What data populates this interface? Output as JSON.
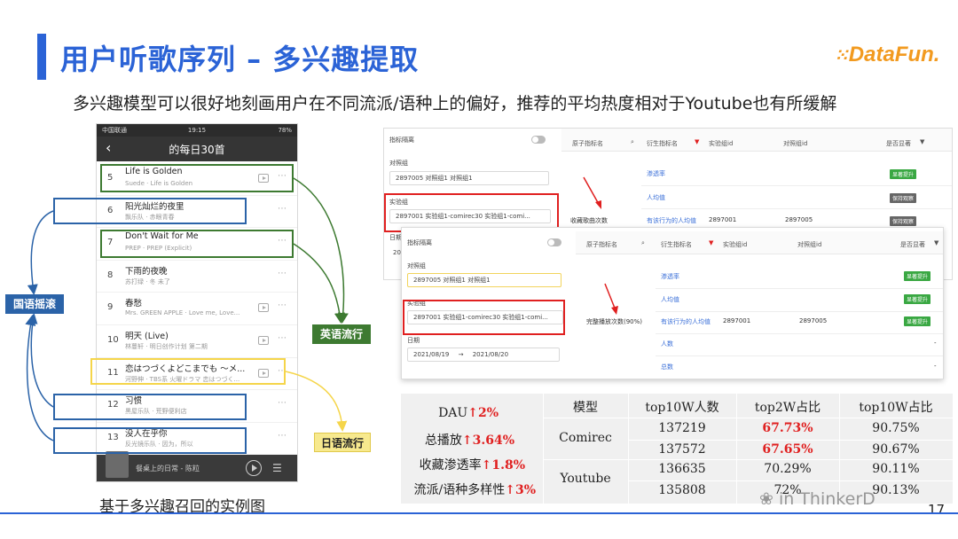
{
  "slide": {
    "title": "用户听歌序列 – 多兴趣提取",
    "logo": "DataFun.",
    "subtitle": "多兴趣模型可以很好地刻画用户在不同流派/语种上的偏好，推荐的平均热度相对于Youtube也有所缓解",
    "page_number": "17",
    "watermark": "in ThinkerD"
  },
  "phone": {
    "status_left": "中国联通",
    "status_time": "19:15",
    "status_right": "78%",
    "back_glyph": "‹",
    "header_title": "的每日30首",
    "songs": [
      {
        "num": "5",
        "name": "Life is Golden",
        "meta": "Suede · Life is Golden"
      },
      {
        "num": "6",
        "name": "阳光灿烂的夜里",
        "meta": "飘乐队 · 赤眼青春"
      },
      {
        "num": "7",
        "name": "Don't Wait for Me",
        "meta": "PREP · PREP (Explicit)"
      },
      {
        "num": "8",
        "name": "下雨的夜晚",
        "meta": "苏打绿 · 冬 未了"
      },
      {
        "num": "9",
        "name": "春愁",
        "meta": "Mrs. GREEN APPLE · Love me, Love..."
      },
      {
        "num": "10",
        "name": "明天 (Live)",
        "meta": "林蔓轩 · 明日创作计划 第二期"
      },
      {
        "num": "11",
        "name": "恋はつづくよどこまでも ～メ...",
        "meta": "河野伸 · TBS系 火曜ドラマ 恋はつづく..."
      },
      {
        "num": "12",
        "name": "习惯",
        "meta": "黑屋乐队 · 荒野便利店"
      },
      {
        "num": "13",
        "name": "没人在乎你",
        "meta": "反光镜乐队 · 因为，所以"
      }
    ],
    "player_text": "餐桌上的日常 - 陈粒",
    "caption": "基于多兴趣召回的实例图"
  },
  "annotations": {
    "guoyu": "国语摇滚",
    "yingyu": "英语流行",
    "riyu": "日语流行",
    "blue": "#2b63a8",
    "green": "#3d7a31",
    "yellow": "#f5d54a"
  },
  "panel_top": {
    "toggle_label": "指标隔离",
    "control_label": "对照组",
    "control_value": "2897005 对照组1 对照组1",
    "exp_label": "实验组",
    "exp_value": "2897001 实验组1-comirec30 实验组1-comi...",
    "date_label": "日期",
    "date_value": "20",
    "headers": [
      "原子指标名",
      "衍生指标名",
      "实验组id",
      "对照组id",
      "是否显著"
    ],
    "atom_name": "收藏歌曲次数",
    "derived": [
      "渗透率",
      "人均值",
      "有该行为的人均值"
    ],
    "exp_id": "2897001",
    "ctrl_id": "2897005",
    "badges": [
      "显著提升",
      "保持观察",
      "保持观察"
    ]
  },
  "panel_bottom": {
    "toggle_label": "指标隔离",
    "control_label": "对照组",
    "control_value": "2897005 对照组1 对照组1",
    "exp_label": "实验组",
    "exp_value": "2897001 实验组1-comirec30 实验组1-comi...",
    "date_label": "日期",
    "date_from": "2021/08/19",
    "date_arrow": "→",
    "date_to": "2021/08/20",
    "headers": [
      "原子指标名",
      "衍生指标名",
      "实验组id",
      "对照组id",
      "是否显著"
    ],
    "atom_name": "完整播放次数(90%)",
    "derived": [
      "渗透率",
      "人均值",
      "有该行为的人均值",
      "人数",
      "总数"
    ],
    "exp_id": "2897001",
    "ctrl_id": "2897005",
    "badges": [
      "显著提升",
      "显著提升",
      "显著提升"
    ],
    "dash": "-"
  },
  "metrics": [
    {
      "label": "DAU",
      "value": "↑2%"
    },
    {
      "label": "总播放",
      "value": "↑3.64%"
    },
    {
      "label": "收藏渗透率",
      "value": "↑1.8%"
    },
    {
      "label": "流派/语种多样性",
      "value": "↑3%"
    }
  ],
  "results_table": {
    "headers": [
      "模型",
      "top10W人数",
      "top2W占比",
      "top10W占比"
    ],
    "groups": [
      {
        "model": "Comirec",
        "rows": [
          [
            "137219",
            "67.73%",
            "90.75%"
          ],
          [
            "137572",
            "67.65%",
            "90.67%"
          ]
        ]
      },
      {
        "model": "Youtube",
        "rows": [
          [
            "136635",
            "70.29%",
            "90.11%"
          ],
          [
            "135808",
            "72%",
            "90.13%"
          ]
        ]
      }
    ]
  }
}
